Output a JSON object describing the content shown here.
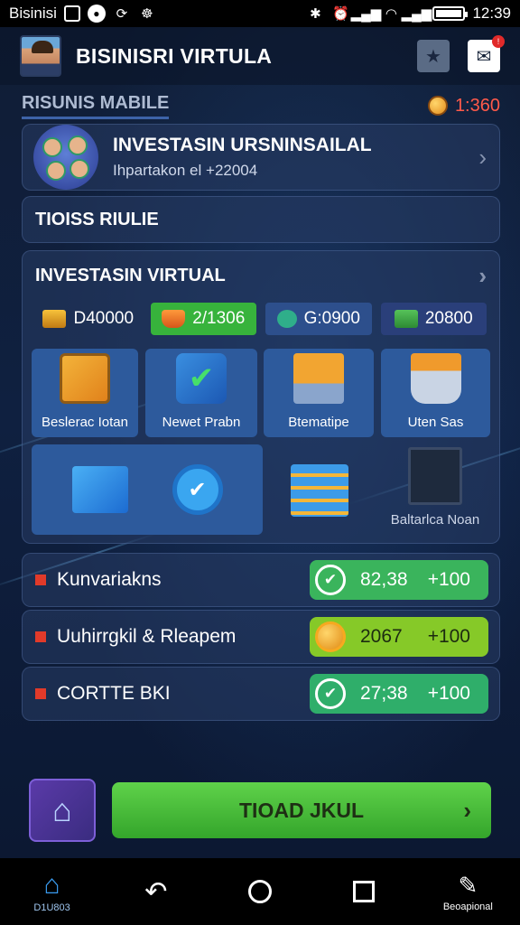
{
  "status_bar": {
    "carrier": "Bisinisi",
    "time": "12:39"
  },
  "header": {
    "title": "BISINISRI VIRTULA"
  },
  "section": {
    "label": "RISUNIS MABILE",
    "balance": "1:360"
  },
  "profile": {
    "title": "INVESTASIN URSNINSAILAL",
    "subtitle": "Ihpartakon el +22004"
  },
  "banner": {
    "text": "TIOISS RIULIE"
  },
  "investment": {
    "title": "INVESTASIN VIRTUAL",
    "stats": [
      "D40000",
      "2/1306",
      "G:0900",
      "20800"
    ],
    "tiles": [
      {
        "label": "Beslerac Iotan"
      },
      {
        "label": "Newet Prabn"
      },
      {
        "label": "Btematipe"
      },
      {
        "label": "Uten Sas"
      },
      {
        "label": ""
      },
      {
        "label": ""
      },
      {
        "label": "Baltarlca Noan"
      }
    ]
  },
  "rewards": [
    {
      "label": "Kunvariakns",
      "value": "82,38",
      "bonus": "+100",
      "color": "#3ab45c"
    },
    {
      "label": "Uuhirrgkil & Rleapem",
      "value": "2067",
      "bonus": "+100",
      "color": "#86c928"
    },
    {
      "label": "CORTTE BKI",
      "value": "27;38",
      "bonus": "+100",
      "color": "#2fae6a"
    }
  ],
  "action": {
    "cta_label": "TIOAD JKUL"
  },
  "navbar": {
    "home_label": "D1U803",
    "profile_label": "Beoapional"
  },
  "colors": {
    "accent_green": "#37b33c",
    "accent_red": "#e13a2a",
    "background": "#0d1a30"
  }
}
